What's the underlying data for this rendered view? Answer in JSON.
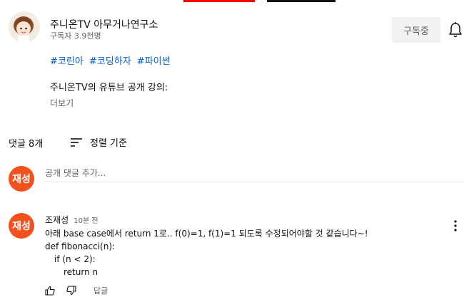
{
  "colors": {
    "progress_red": "#ff0000",
    "link_blue": "#065fd4",
    "avatar_orange": "#f4511e",
    "secondary_text": "#606060"
  },
  "channel": {
    "name": "주니온TV 아무거나연구소",
    "subscribers": "구독자 3.9천명",
    "subscribe_label": "구독중",
    "bell_icon": "bell-icon"
  },
  "description": {
    "hashtags": [
      "#코린아",
      "#코딩하자",
      "#파이썬"
    ],
    "line": "주니온TV의 유튜브 공개 강의:",
    "more": "더보기"
  },
  "comments_header": {
    "count": "댓글 8개",
    "sort_label": "정렬 기준",
    "sort_icon": "sort-icon"
  },
  "add_comment": {
    "avatar_text": "재성",
    "placeholder": "공개 댓글 추가..."
  },
  "comment": {
    "avatar_text": "재성",
    "author": "조재성",
    "time": "10분 전",
    "text": "아래 base case에서 return 1로.. f(0)=1, f(1)=1 되도록 수정되어야할 것 같습니다~!",
    "code": [
      "def fibonacci(n):",
      "if (n < 2):",
      "return n"
    ],
    "reply_label": "답글",
    "like_icon": "thumbs-up-icon",
    "dislike_icon": "thumbs-down-icon",
    "menu_icon": "more-vert-icon"
  }
}
